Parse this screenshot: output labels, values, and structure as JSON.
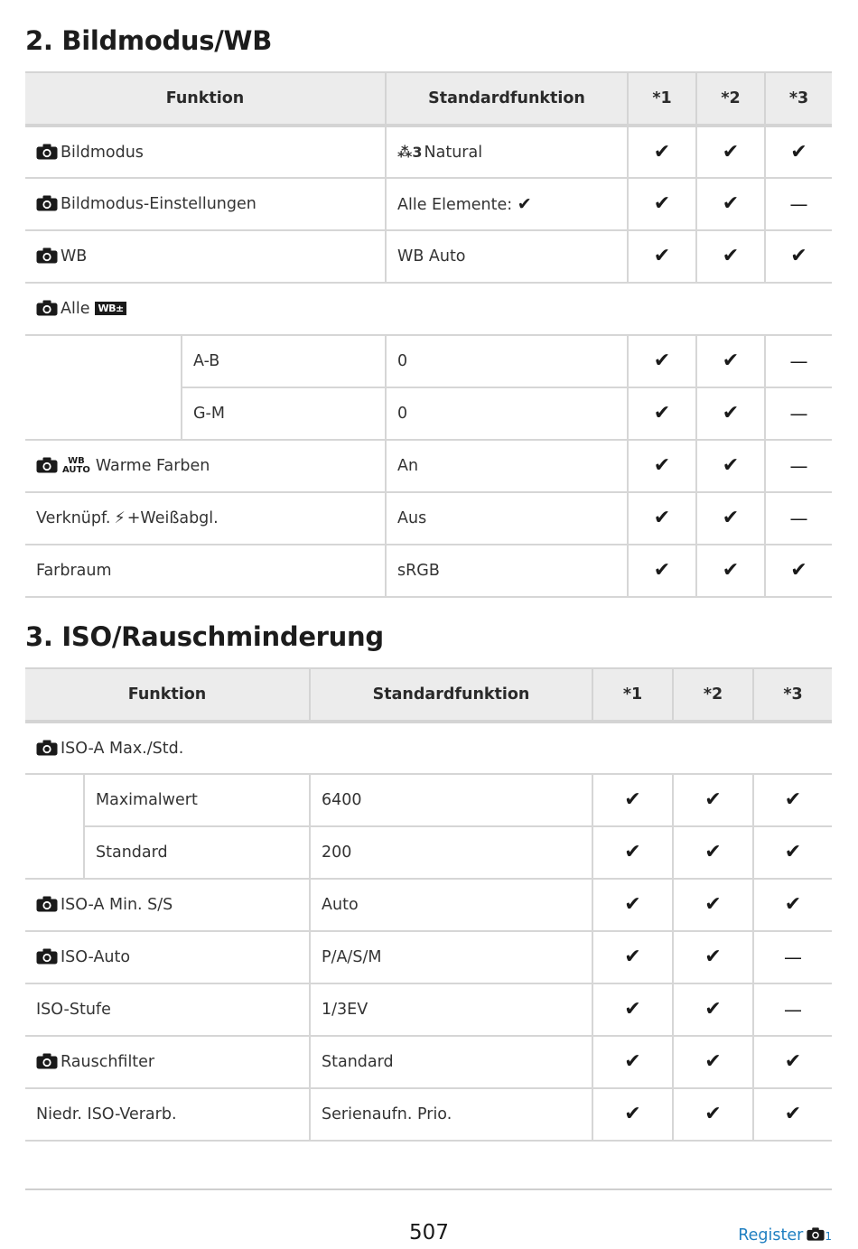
{
  "section2": {
    "title": "2. Bildmodus/WB",
    "headers": {
      "function": "Funktion",
      "default": "Standardfunktion",
      "c1": "*1",
      "c2": "*2",
      "c3": "*3"
    },
    "rows": {
      "bildmodus": {
        "label": "Bildmodus",
        "value": "Natural",
        "value_prefix": "3",
        "c1": "✔",
        "c2": "✔",
        "c3": "✔"
      },
      "bildmodus_einst": {
        "label": "Bildmodus-Einstellungen",
        "value": "Alle Elemente:",
        "c1": "✔",
        "c2": "✔",
        "c3": "—"
      },
      "wb": {
        "label": "WB",
        "value": "WB Auto",
        "c1": "✔",
        "c2": "✔",
        "c3": "✔"
      },
      "alle": {
        "label": "Alle",
        "badge": "WB±"
      },
      "ab": {
        "label": "A-B",
        "value": "0",
        "c1": "✔",
        "c2": "✔",
        "c3": "—"
      },
      "gm": {
        "label": "G-M",
        "value": "0",
        "c1": "✔",
        "c2": "✔",
        "c3": "—"
      },
      "warme": {
        "icon_top": "WB",
        "icon_bottom": "AUTO",
        "label": "Warme Farben",
        "value": "An",
        "c1": "✔",
        "c2": "✔",
        "c3": "—"
      },
      "verknuepf": {
        "label_a": "Verknüpf.",
        "label_b": "+Weißabgl.",
        "value": "Aus",
        "c1": "✔",
        "c2": "✔",
        "c3": "—"
      },
      "farbraum": {
        "label": "Farbraum",
        "value": "sRGB",
        "c1": "✔",
        "c2": "✔",
        "c3": "✔"
      }
    }
  },
  "section3": {
    "title": "3. ISO/Rauschminderung",
    "headers": {
      "function": "Funktion",
      "default": "Standardfunktion",
      "c1": "*1",
      "c2": "*2",
      "c3": "*3"
    },
    "rows": {
      "iso_a_max": {
        "label": "ISO-A Max./Std."
      },
      "maximalwert": {
        "label": "Maximalwert",
        "value": "6400",
        "c1": "✔",
        "c2": "✔",
        "c3": "✔"
      },
      "standard": {
        "label": "Standard",
        "value": "200",
        "c1": "✔",
        "c2": "✔",
        "c3": "✔"
      },
      "iso_a_min": {
        "label": "ISO-A Min. S/S",
        "value": "Auto",
        "c1": "✔",
        "c2": "✔",
        "c3": "✔"
      },
      "iso_auto": {
        "label": "ISO-Auto",
        "value": "P/A/S/M",
        "c1": "✔",
        "c2": "✔",
        "c3": "—"
      },
      "iso_stufe": {
        "label": "ISO-Stufe",
        "value": "1/3EV",
        "c1": "✔",
        "c2": "✔",
        "c3": "—"
      },
      "rauschfilter": {
        "label": "Rauschfilter",
        "value": "Standard",
        "c1": "✔",
        "c2": "✔",
        "c3": "✔"
      },
      "niedr_iso": {
        "label": "Niedr. ISO-Verarb.",
        "value": "Serienaufn. Prio.",
        "c1": "✔",
        "c2": "✔",
        "c3": "✔"
      }
    }
  },
  "footer": {
    "page_number": "507",
    "register": "Register",
    "register_icon_sub": "1"
  },
  "icons": {
    "camera": "camera-icon",
    "check": "check-icon",
    "flash": "flash-icon",
    "picture-mode": "picture-mode-icon"
  }
}
